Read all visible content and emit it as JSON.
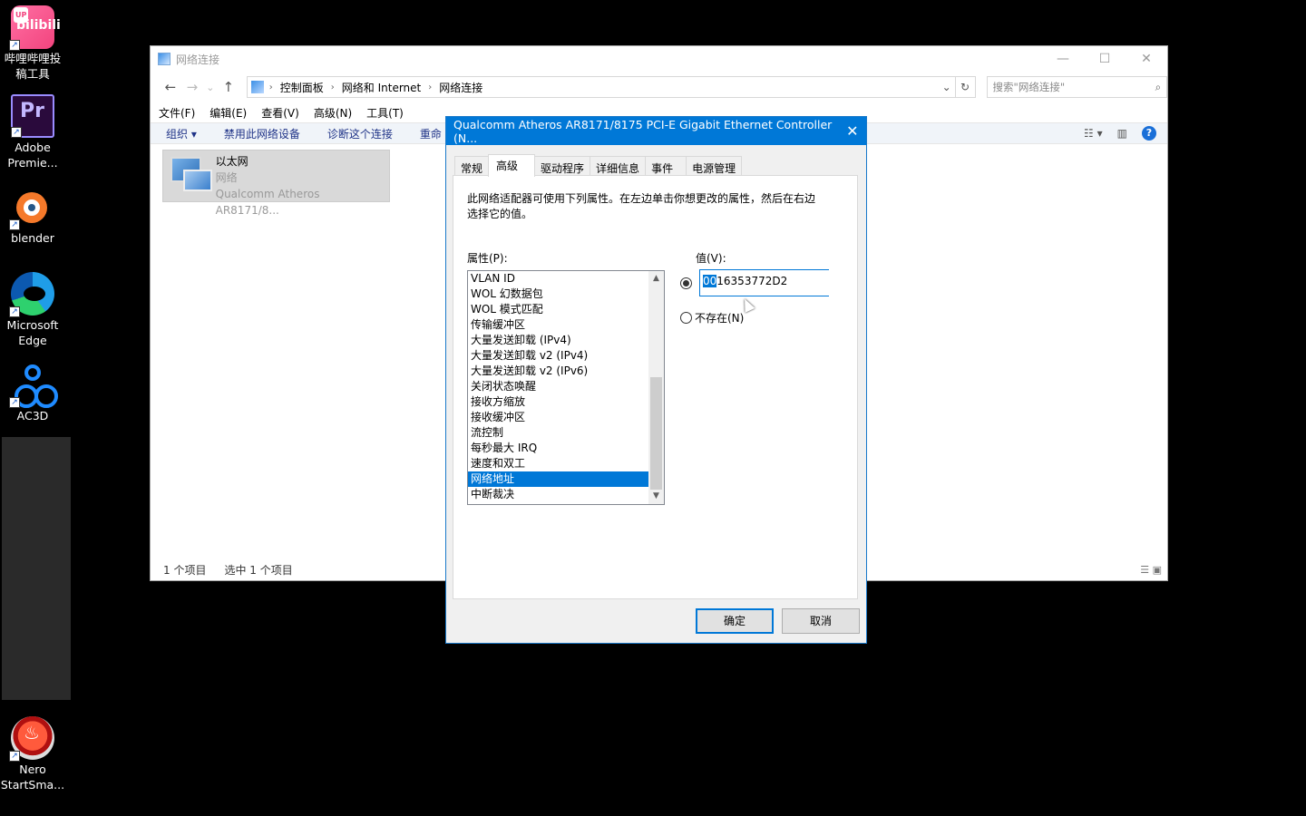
{
  "desktop": {
    "icons": [
      {
        "label": "哔哩哔哩投稿工具",
        "badge": "UP",
        "glyph": "bilibili"
      },
      {
        "label": "Adobe Premie...",
        "glyph": "Pr"
      },
      {
        "label": "blender"
      },
      {
        "label": "Microsoft Edge"
      },
      {
        "label": "AC3D"
      },
      {
        "label": "Nero StartSma..."
      }
    ]
  },
  "explorer": {
    "title": "网络连接",
    "controls": {
      "minimize": "—",
      "maximize": "☐",
      "close": "✕"
    },
    "nav": {
      "back": "←",
      "forward": "→",
      "recent": "⌄",
      "up": "↑"
    },
    "breadcrumb": [
      "控制面板",
      "网络和 Internet",
      "网络连接"
    ],
    "crumb_separator": "›",
    "search_placeholder": "搜索\"网络连接\"",
    "menu": [
      "文件(F)",
      "编辑(E)",
      "查看(V)",
      "高级(N)",
      "工具(T)"
    ],
    "commands": [
      "组织 ▾",
      "禁用此网络设备",
      "诊断这个连接",
      "重命"
    ],
    "item": {
      "name": "以太网",
      "type": "网络",
      "device": "Qualcomm Atheros AR8171/8..."
    },
    "status": {
      "count": "1 个项目",
      "selected": "选中 1 个项目"
    }
  },
  "dialog": {
    "title": "Qualcomm Atheros AR8171/8175 PCI-E Gigabit Ethernet Controller (N...",
    "close": "✕",
    "tabs": [
      "常规",
      "高级",
      "驱动程序",
      "详细信息",
      "事件",
      "电源管理"
    ],
    "active_tab": "高级",
    "description": "此网络适配器可使用下列属性。在左边单击你想更改的属性，然后在右边选择它的值。",
    "property_label": "属性(P):",
    "value_label": "值(V):",
    "properties": [
      "VLAN ID",
      "WOL 幻数据包",
      "WOL 模式匹配",
      "传输缓冲区",
      "大量发送卸载 (IPv4)",
      "大量发送卸载 v2 (IPv4)",
      "大量发送卸载 v2 (IPv6)",
      "关闭状态唤醒",
      "接收方缩放",
      "接收缓冲区",
      "流控制",
      "每秒最大 IRQ",
      "速度和双工",
      "网络地址",
      "中断裁决"
    ],
    "selected_property": "网络地址",
    "value_selected_part": "00",
    "value_rest": "16353772D2",
    "not_present_label": "不存在(N)",
    "ok": "确定",
    "cancel": "取消"
  },
  "colors": {
    "accent": "#0078d7",
    "selection": "#0078d7",
    "link": "#1e3287"
  }
}
